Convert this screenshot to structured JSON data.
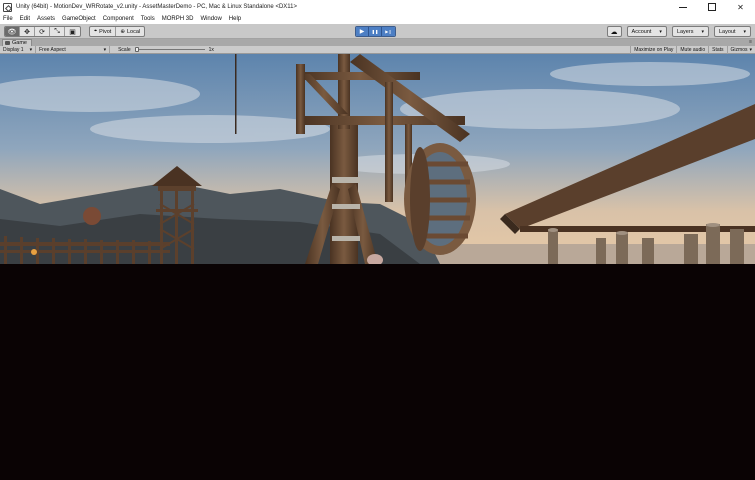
{
  "window": {
    "title": "Unity (64bit) - MotionDev_WRRotate_v2.unity - AssetMasterDemo - PC, Mac & Linux Standalone <DX11>",
    "minimize_glyph": "",
    "maximize_glyph": "",
    "close_glyph": "✕"
  },
  "menu": {
    "items": [
      "File",
      "Edit",
      "Assets",
      "GameObject",
      "Component",
      "Tools",
      "MORPH 3D",
      "Window",
      "Help"
    ]
  },
  "toolbar": {
    "tools": [
      {
        "name": "hand-tool",
        "glyph": "👁"
      },
      {
        "name": "move-tool",
        "glyph": "✥"
      },
      {
        "name": "rotate-tool",
        "glyph": "⟳"
      },
      {
        "name": "scale-tool",
        "glyph": "⤡"
      },
      {
        "name": "rect-tool",
        "glyph": "▣"
      }
    ],
    "pivot_label": "Pivot",
    "local_label": "Local",
    "play_glyph": "▶",
    "pause_glyph": "❚❚",
    "step_glyph": "▶❙",
    "cloud_glyph": "☁",
    "account_label": "Account",
    "layers_label": "Layers",
    "layout_label": "Layout",
    "chevron": "▾"
  },
  "game_view": {
    "tab_label": "Game",
    "tab_menu_glyph": "≡",
    "display_label": "Display 1",
    "aspect_label": "Free Aspect",
    "scale_label": "Scale",
    "scale_value": "1x",
    "scale_fraction": 0.0,
    "maximize_on_play": "Maximize on Play",
    "mute_audio": "Mute audio",
    "stats": "Stats",
    "gizmos": "Gizmos"
  },
  "colors": {
    "play_blue": "#4d7fc4",
    "toolbar_gray": "#c8c8c8",
    "wood": "#6b4a33",
    "sky_top": "#5f84ab"
  }
}
